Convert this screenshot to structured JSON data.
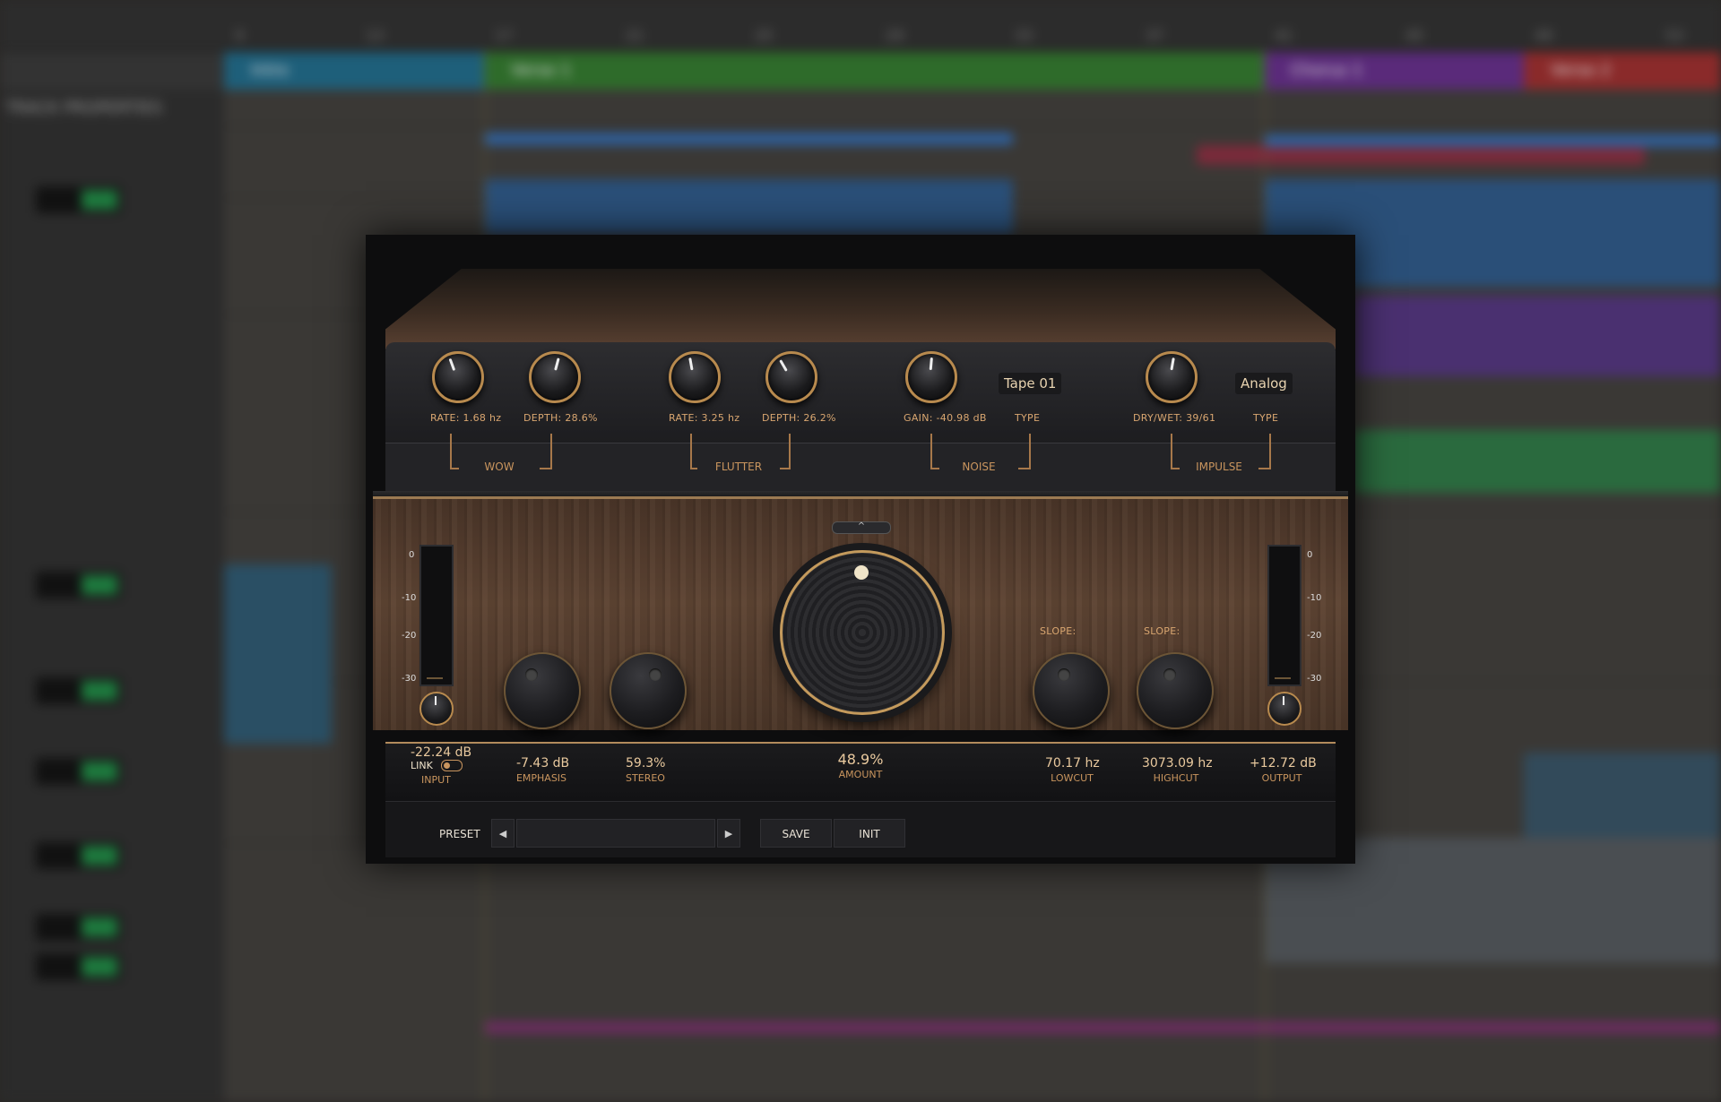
{
  "daw": {
    "ruler_ticks": [
      "9",
      "13",
      "17",
      "21",
      "25",
      "29",
      "33",
      "37",
      "41",
      "45",
      "49",
      "53",
      "57"
    ],
    "markers": [
      {
        "label": "Intro",
        "color": "#1e5f7a"
      },
      {
        "label": "Verse 1",
        "color": "#2e6b2a"
      },
      {
        "label": "Chorus 1",
        "color": "#5a2a7a"
      },
      {
        "label": "Verse 2",
        "color": "#8a2a2a"
      }
    ],
    "panel_title": "TRACK PROPERTIES"
  },
  "plugin": {
    "fx": {
      "wow": {
        "title": "WOW",
        "rate": "RATE: 1.68 hz",
        "depth": "DEPTH: 28.6%"
      },
      "flutter": {
        "title": "FLUTTER",
        "rate": "RATE: 3.25 hz",
        "depth": "DEPTH:  26.2%"
      },
      "noise": {
        "title": "NOISE",
        "gain": "GAIN: -40.98 dB",
        "type_label": "TYPE",
        "type_value": "Tape 01"
      },
      "impulse": {
        "title": "IMPULSE",
        "drywet": "DRY/WET:  39/61",
        "type_label": "TYPE",
        "type_value": "Analog"
      }
    },
    "collapse": "^",
    "meters": {
      "ticks": [
        "0",
        "-10",
        "-20",
        "-30"
      ]
    },
    "slope_left": "SLOPE:",
    "slope_right": "SLOPE:",
    "display": {
      "input": {
        "value": "-22.24 dB",
        "label": "INPUT",
        "link": "LINK"
      },
      "emphasis": {
        "value": "-7.43 dB",
        "label": "EMPHASIS"
      },
      "stereo": {
        "value": "59.3%",
        "label": "STEREO"
      },
      "amount": {
        "value": "48.9%",
        "label": "AMOUNT"
      },
      "lowcut": {
        "value": "70.17 hz",
        "label": "LOWCUT"
      },
      "highcut": {
        "value": "3073.09 hz",
        "label": "HIGHCUT"
      },
      "output": {
        "value": "+12.72 dB",
        "label": "OUTPUT"
      }
    },
    "preset": {
      "label": "PRESET",
      "prev": "◀",
      "next": "▶",
      "name": "",
      "save": "SAVE",
      "init": "INIT"
    }
  }
}
